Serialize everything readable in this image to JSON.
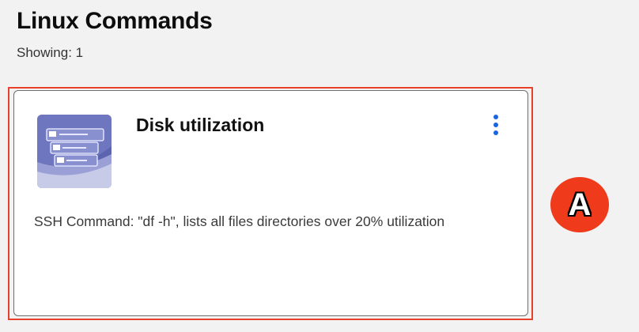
{
  "header": {
    "title": "Linux Commands",
    "count_label": "Showing: 1"
  },
  "card": {
    "title": "Disk utilization",
    "description": "SSH Command: \"df -h\", lists all files directories over 20% utilization",
    "thumbnail_icon": "server-stack-icon",
    "menu_icon": "kebab-menu-icon"
  },
  "annotation": {
    "label": "A"
  },
  "colors": {
    "background": "#f2f2f2",
    "highlight": "#e8402a",
    "menu_dots": "#1a66e0",
    "badge": "#ef3a1b",
    "thumbnail": "#5c64b0"
  }
}
